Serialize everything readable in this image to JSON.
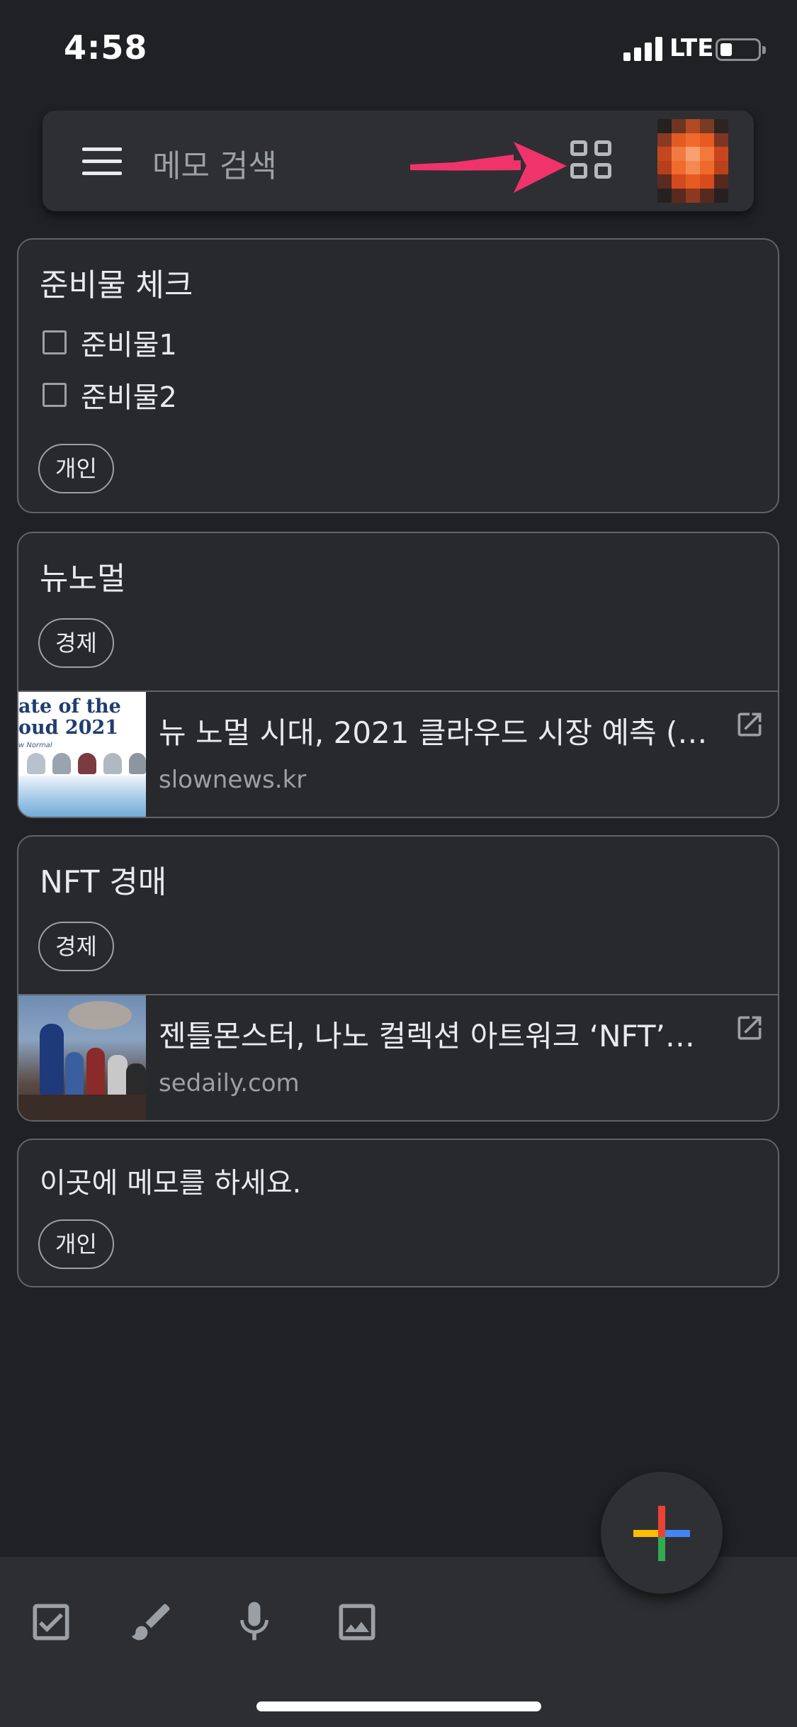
{
  "status_bar": {
    "time": "4:58",
    "network": "LTE"
  },
  "search": {
    "placeholder": "메모 검색"
  },
  "icons": {
    "menu": "hamburger-menu-icon",
    "layout": "grid-view-icon",
    "open_link": "open-in-new-icon",
    "add": "plus-icon",
    "checklist": "checkbox-icon",
    "drawing": "brush-icon",
    "voice": "microphone-icon",
    "image": "image-icon"
  },
  "colors": {
    "background": "#202124",
    "card_border": "#5f6368",
    "annotation_arrow": "#f0336b"
  },
  "notes": [
    {
      "title": "준비물 체크",
      "checklist": [
        {
          "label": "준비물1",
          "checked": false
        },
        {
          "label": "준비물2",
          "checked": false
        }
      ],
      "label": "개인"
    },
    {
      "title": "뉴노멀",
      "label": "경제",
      "link": {
        "title": "뉴 노멀 시대, 2021 클라우드 시장 예측 (…",
        "domain": "slownews.kr",
        "thumb_line1": "ate of the",
        "thumb_line2": "oud 2021",
        "thumb_line3": "w Normal"
      }
    },
    {
      "title": "NFT 경매",
      "label": "경제",
      "link": {
        "title": "젠틀몬스터, 나노 컬렉션 아트워크 ‘NFT’…",
        "domain": "sedaily.com"
      }
    },
    {
      "body": "이곳에 메모를 하세요.",
      "label": "개인"
    }
  ]
}
